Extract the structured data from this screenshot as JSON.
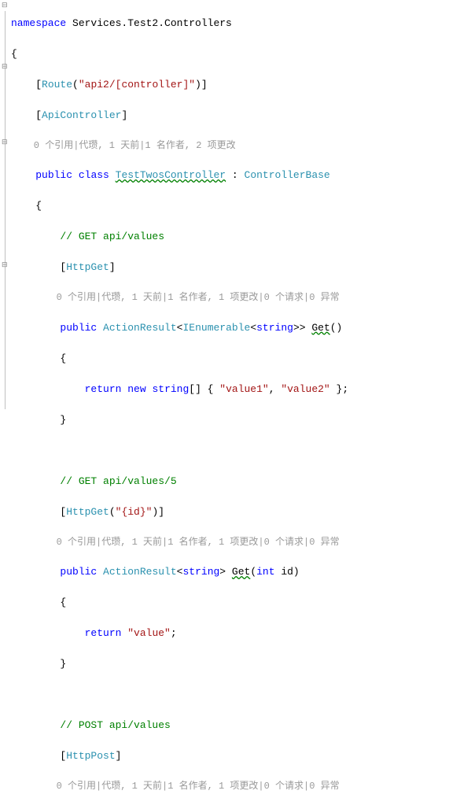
{
  "chart_data": null,
  "colors": {
    "keyword": "#0000ff",
    "type": "#2b91af",
    "string": "#a31515",
    "comment": "#008000",
    "codelens": "#999999"
  },
  "code": {
    "ns_kw": "namespace",
    "ns_name": " Services.Test2.Controllers",
    "brace_open": "{",
    "route_attr_open": "    [",
    "route_type": "Route",
    "route_paren_open": "(",
    "route_str": "\"api2/[controller]\"",
    "route_paren_close": ")]",
    "apicontroller_open": "    [",
    "apicontroller_type": "ApiController",
    "apicontroller_close": "]",
    "codelens1": "    0 个引用|代瓒, 1 天前|1 名作者, 2 项更改",
    "class_indent": "    ",
    "public_kw": "public",
    "class_kw": "class",
    "class_name": "TestTwosController",
    "colon": " : ",
    "base_class": "ControllerBase",
    "class_brace_open": "    {",
    "get_comment": "        // GET api/values",
    "httpget_open": "        [",
    "httpget_type": "HttpGet",
    "httpget_close": "]",
    "codelens2": "        0 个引用|代瓒, 1 天前|1 名作者, 1 项更改|0 个请求|0 异常",
    "m1_indent": "        ",
    "actionresult": "ActionResult",
    "lt": "<",
    "ienumerable": "IEnumerable",
    "string_type": "string",
    "gt": ">",
    "gt2": ">> ",
    "get_name": "Get",
    "get_parens": "()",
    "m1_brace_open": "        {",
    "return_indent": "            ",
    "return_kw": "return",
    "new_kw": "new",
    "string_kw2": "string",
    "arr_open": "[] { ",
    "val1": "\"value1\"",
    "comma": ", ",
    "val2": "\"value2\"",
    "arr_close": " };",
    "m1_brace_close": "        }",
    "get5_comment": "        // GET api/values/5",
    "httpget2_open": "        [",
    "httpget2_type": "HttpGet",
    "httpget2_paren_open": "(",
    "httpget2_str": "\"{id}\"",
    "httpget2_close": ")]",
    "codelens3": "        0 个引用|代瓒, 1 天前|1 名作者, 1 项更改|0 个请求|0 异常",
    "m2_indent": "        ",
    "gt_single": "> ",
    "get2_name": "Get",
    "get2_open": "(",
    "int_kw": "int",
    "id_param": " id)",
    "m2_brace_open": "        {",
    "return2_indent": "            ",
    "value_str": "\"value\"",
    "semicolon": ";",
    "m2_brace_close": "        }",
    "post_comment": "        // POST api/values",
    "httppost_open": "        [",
    "httppost_type": "HttpPost",
    "httppost_close": "]",
    "codelens4": "        0 个引用|代瓒, 1 天前|1 名作者, 1 项更改|0 个请求|0 异常"
  }
}
